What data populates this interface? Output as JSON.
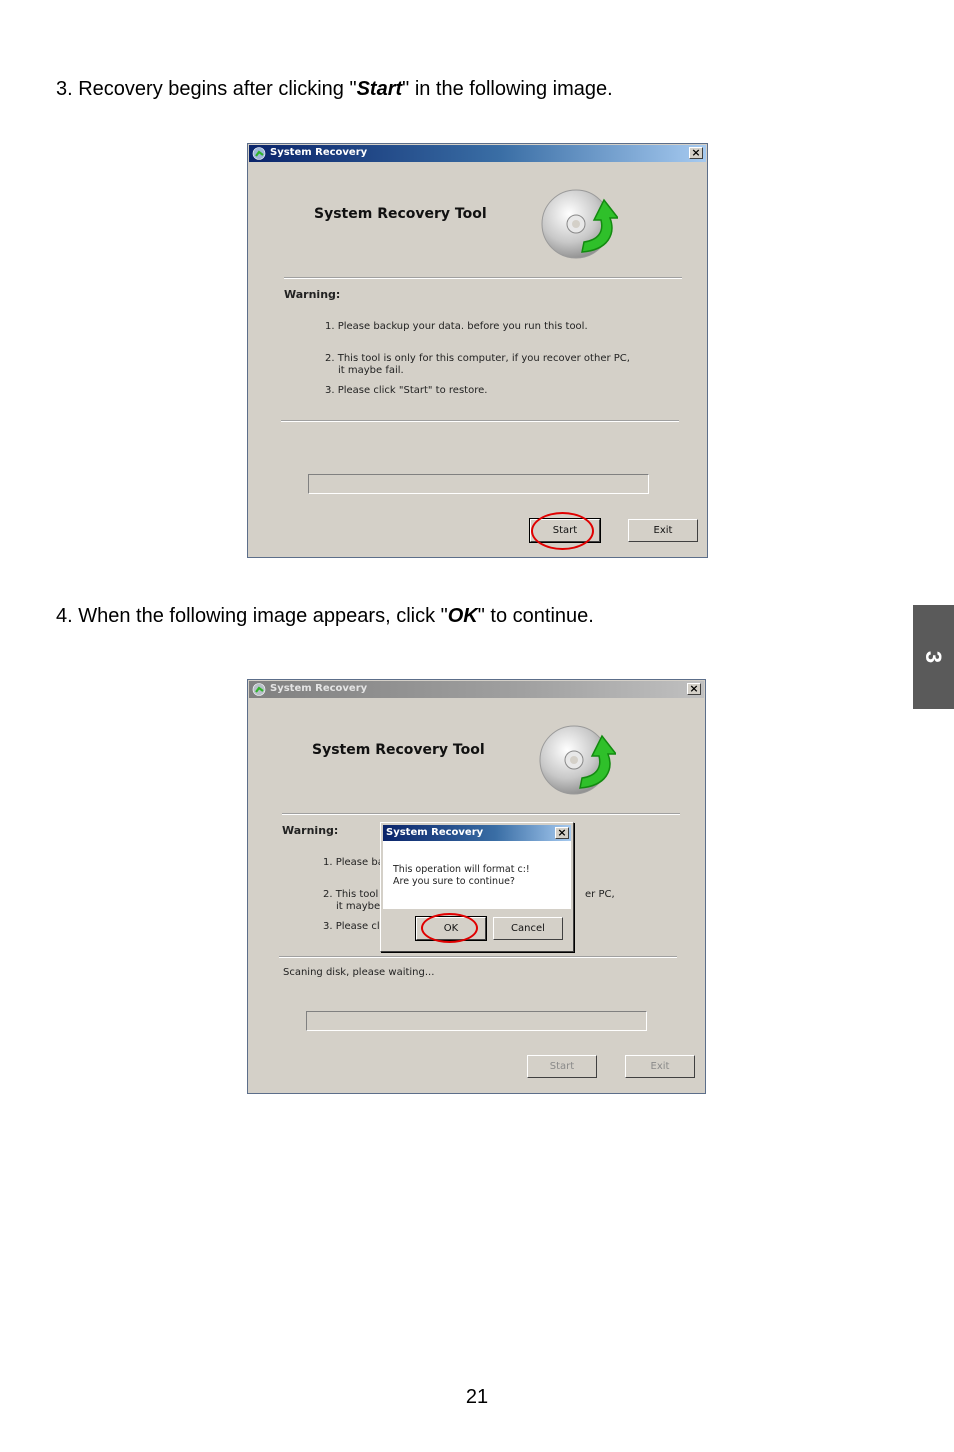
{
  "step3": {
    "prefix": "3. Recovery begins after clicking \"",
    "emph": "Start",
    "suffix": "\" in the following image."
  },
  "step4": {
    "prefix": "4. When the following image appears, click \"",
    "emph": "OK",
    "suffix": "\" to continue."
  },
  "side_tab": "3",
  "page_number": "21",
  "window1": {
    "title": "System Recovery",
    "close_glyph": "×",
    "app_title": "System Recovery Tool",
    "warning_label": "Warning:",
    "lines": [
      "1. Please backup your data. before you run this tool.",
      "2. This tool is only for this computer, if you recover other PC,",
      "it maybe fail.",
      "3. Please click \"Start\" to restore."
    ],
    "start_label": "Start",
    "exit_label": "Exit"
  },
  "window2": {
    "title": "System Recovery",
    "close_glyph": "×",
    "app_title": "System Recovery Tool",
    "warning_label": "Warning:",
    "visible_lines": [
      "1. Please ba",
      "2. This tool is",
      "it maybe",
      "3. Please clic",
      "er PC,"
    ],
    "status": "Scaning disk, please waiting...",
    "start_label": "Start",
    "exit_label": "Exit",
    "dialog": {
      "title": "System Recovery",
      "close_glyph": "×",
      "message_line1": "This operation will format c:!",
      "message_line2": "Are you sure to continue?",
      "ok_label": "OK",
      "cancel_label": "Cancel"
    }
  },
  "colors": {
    "highlight_circle": "#e00000",
    "window_bg": "#d4d0c8",
    "side_tab": "#5a5a5a"
  }
}
